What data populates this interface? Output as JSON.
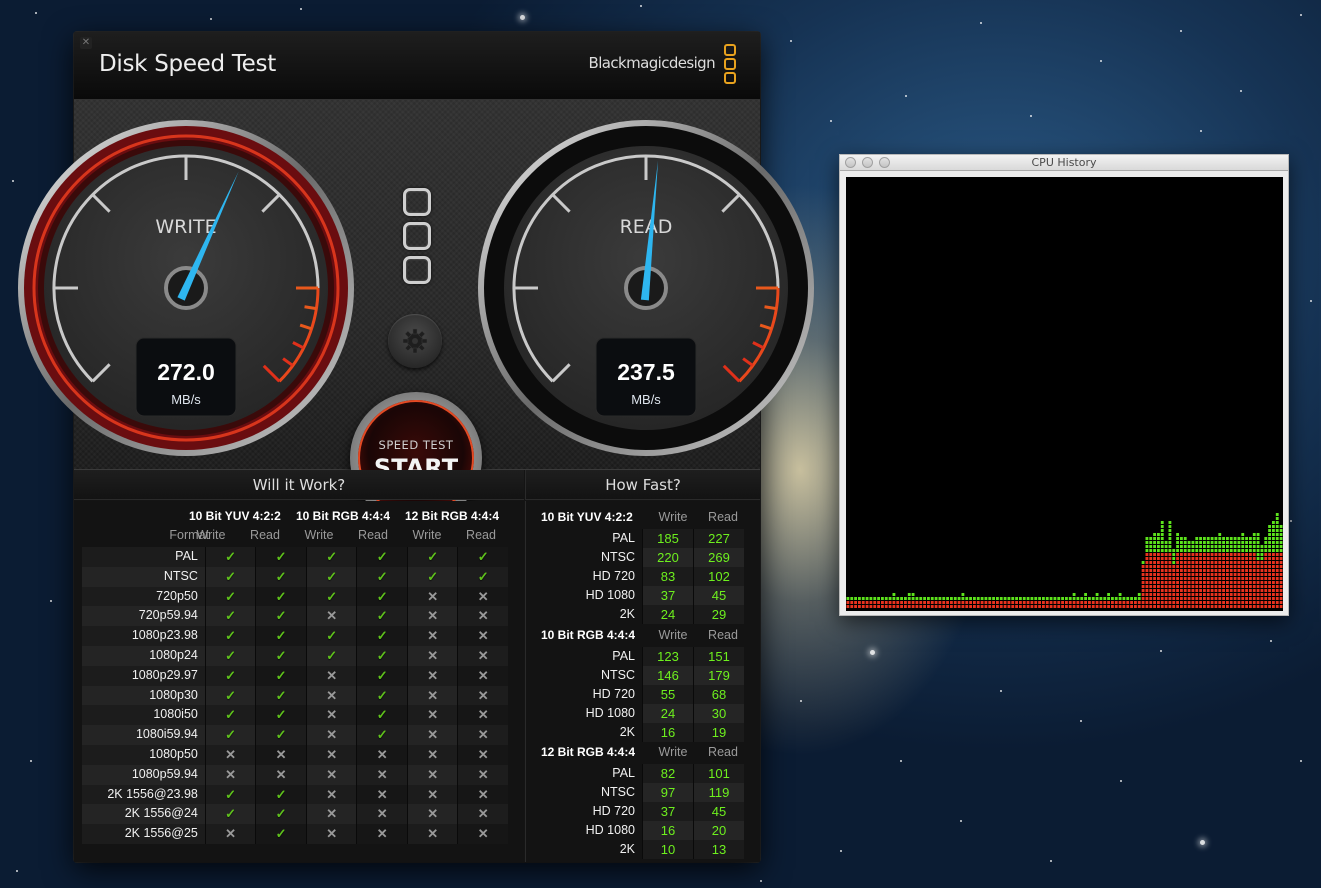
{
  "desktop": {
    "background": "Mountain Lion galaxy wallpaper"
  },
  "disk_speed_test": {
    "title": "Disk Speed Test",
    "brand": "Blackmagicdesign",
    "close_icon": "close-icon",
    "gauges": {
      "write": {
        "label": "WRITE",
        "value": "272.0",
        "unit": "MB/s",
        "needle_fraction": 0.59
      },
      "read": {
        "label": "READ",
        "value": "237.5",
        "unit": "MB/s",
        "needle_fraction": 0.52
      }
    },
    "settings_icon": "gear-icon",
    "start_button": {
      "sub": "SPEED TEST",
      "main": "START"
    },
    "will_it_work": {
      "title": "Will it Work?",
      "groups": [
        "10 Bit YUV 4:2:2",
        "10 Bit RGB 4:4:4",
        "12 Bit RGB 4:4:4"
      ],
      "format_label": "Format",
      "write_label": "Write",
      "read_label": "Read",
      "rows": [
        {
          "format": "PAL",
          "results": [
            true,
            true,
            true,
            true,
            true,
            true
          ]
        },
        {
          "format": "NTSC",
          "results": [
            true,
            true,
            true,
            true,
            true,
            true
          ]
        },
        {
          "format": "720p50",
          "results": [
            true,
            true,
            true,
            true,
            false,
            false
          ]
        },
        {
          "format": "720p59.94",
          "results": [
            true,
            true,
            false,
            true,
            false,
            false
          ]
        },
        {
          "format": "1080p23.98",
          "results": [
            true,
            true,
            true,
            true,
            false,
            false
          ]
        },
        {
          "format": "1080p24",
          "results": [
            true,
            true,
            true,
            true,
            false,
            false
          ]
        },
        {
          "format": "1080p29.97",
          "results": [
            true,
            true,
            false,
            true,
            false,
            false
          ]
        },
        {
          "format": "1080p30",
          "results": [
            true,
            true,
            false,
            true,
            false,
            false
          ]
        },
        {
          "format": "1080i50",
          "results": [
            true,
            true,
            false,
            true,
            false,
            false
          ]
        },
        {
          "format": "1080i59.94",
          "results": [
            true,
            true,
            false,
            true,
            false,
            false
          ]
        },
        {
          "format": "1080p50",
          "results": [
            false,
            false,
            false,
            false,
            false,
            false
          ]
        },
        {
          "format": "1080p59.94",
          "results": [
            false,
            false,
            false,
            false,
            false,
            false
          ]
        },
        {
          "format": "2K 1556@23.98",
          "results": [
            true,
            true,
            false,
            false,
            false,
            false
          ]
        },
        {
          "format": "2K 1556@24",
          "results": [
            true,
            true,
            false,
            false,
            false,
            false
          ]
        },
        {
          "format": "2K 1556@25",
          "results": [
            false,
            true,
            false,
            false,
            false,
            false
          ]
        }
      ],
      "yes_glyph": "✓",
      "no_glyph": "✕"
    },
    "how_fast": {
      "title": "How Fast?",
      "write_label": "Write",
      "read_label": "Read",
      "sections": [
        {
          "name": "10 Bit YUV 4:2:2",
          "rows": [
            {
              "format": "PAL",
              "write": "185",
              "read": "227"
            },
            {
              "format": "NTSC",
              "write": "220",
              "read": "269"
            },
            {
              "format": "HD 720",
              "write": "83",
              "read": "102"
            },
            {
              "format": "HD 1080",
              "write": "37",
              "read": "45"
            },
            {
              "format": "2K",
              "write": "24",
              "read": "29"
            }
          ]
        },
        {
          "name": "10 Bit RGB 4:4:4",
          "rows": [
            {
              "format": "PAL",
              "write": "123",
              "read": "151"
            },
            {
              "format": "NTSC",
              "write": "146",
              "read": "179"
            },
            {
              "format": "HD 720",
              "write": "55",
              "read": "68"
            },
            {
              "format": "HD 1080",
              "write": "24",
              "read": "30"
            },
            {
              "format": "2K",
              "write": "16",
              "read": "19"
            }
          ]
        },
        {
          "name": "12 Bit RGB 4:4:4",
          "rows": [
            {
              "format": "PAL",
              "write": "82",
              "read": "101"
            },
            {
              "format": "NTSC",
              "write": "97",
              "read": "119"
            },
            {
              "format": "HD 720",
              "write": "37",
              "read": "45"
            },
            {
              "format": "HD 1080",
              "write": "16",
              "read": "20"
            },
            {
              "format": "2K",
              "write": "10",
              "read": "13"
            }
          ]
        }
      ]
    }
  },
  "cpu_history": {
    "title": "CPU History",
    "colors": {
      "system": "#e8321e",
      "user": "#5ce21c",
      "background": "#000000"
    },
    "ylim_percent": [
      0,
      100
    ],
    "system_percent": [
      1.5,
      1.5,
      1.5,
      1.5,
      1.5,
      1.5,
      1.5,
      1.5,
      1.5,
      1.5,
      1.5,
      1.5,
      1.5,
      1.5,
      1.5,
      1.5,
      1.5,
      1.5,
      1.5,
      1.5,
      1.5,
      1.5,
      1.5,
      1.5,
      1.5,
      1.5,
      1.5,
      1.5,
      1.5,
      1.5,
      1.5,
      1.5,
      1.5,
      1.5,
      1.5,
      1.5,
      1.5,
      1.5,
      1.5,
      1.5,
      1.5,
      1.5,
      1.5,
      1.5,
      1.5,
      1.5,
      1.5,
      1.5,
      1.5,
      1.5,
      1.5,
      1.5,
      1.5,
      1.5,
      1.5,
      1.5,
      1.5,
      1.5,
      1.5,
      1.5,
      1.5,
      1.5,
      1.5,
      1.5,
      1.5,
      1.5,
      1.5,
      1.5,
      1.5,
      1.5,
      1.5,
      1.5,
      1.5,
      1.5,
      1.5,
      1.5,
      1.5,
      10,
      13,
      13,
      13,
      13,
      13,
      13,
      13,
      10,
      13,
      13,
      13,
      13,
      13,
      13,
      13,
      13,
      13,
      13,
      13,
      13,
      13,
      13,
      13,
      13,
      13,
      13,
      13,
      13,
      13,
      11,
      11,
      13,
      13,
      13,
      13,
      13
    ],
    "user_percent": [
      0.5,
      1,
      0.5,
      0.5,
      0.5,
      0.5,
      0.5,
      0.5,
      0.5,
      0.5,
      0.5,
      0.5,
      1.5,
      0.5,
      0.5,
      0.5,
      1.5,
      1.5,
      1,
      0.5,
      1,
      0.5,
      0.5,
      0.5,
      1,
      0.5,
      0.5,
      1,
      0.5,
      0.5,
      1.5,
      0.5,
      1,
      0.5,
      0.5,
      0.5,
      1,
      0.5,
      0.5,
      0.5,
      0.5,
      0.5,
      0.5,
      0.5,
      0.5,
      1,
      0.5,
      0.5,
      1,
      0.5,
      0.5,
      1,
      0.5,
      0.5,
      0.5,
      1,
      0.5,
      0.5,
      1,
      1.5,
      0.5,
      1,
      1.5,
      1,
      1,
      2,
      0.5,
      1,
      1.5,
      0.5,
      1,
      1.5,
      0.5,
      0.5,
      1,
      0.5,
      1.5,
      1,
      4,
      4,
      5,
      5,
      7,
      3,
      7,
      4,
      5,
      4,
      4,
      3,
      3,
      4,
      4,
      4,
      4,
      4,
      4,
      5,
      4,
      4,
      4,
      4,
      4,
      5,
      4,
      4,
      5,
      6,
      4,
      4,
      6,
      7,
      9,
      6,
      6
    ]
  }
}
